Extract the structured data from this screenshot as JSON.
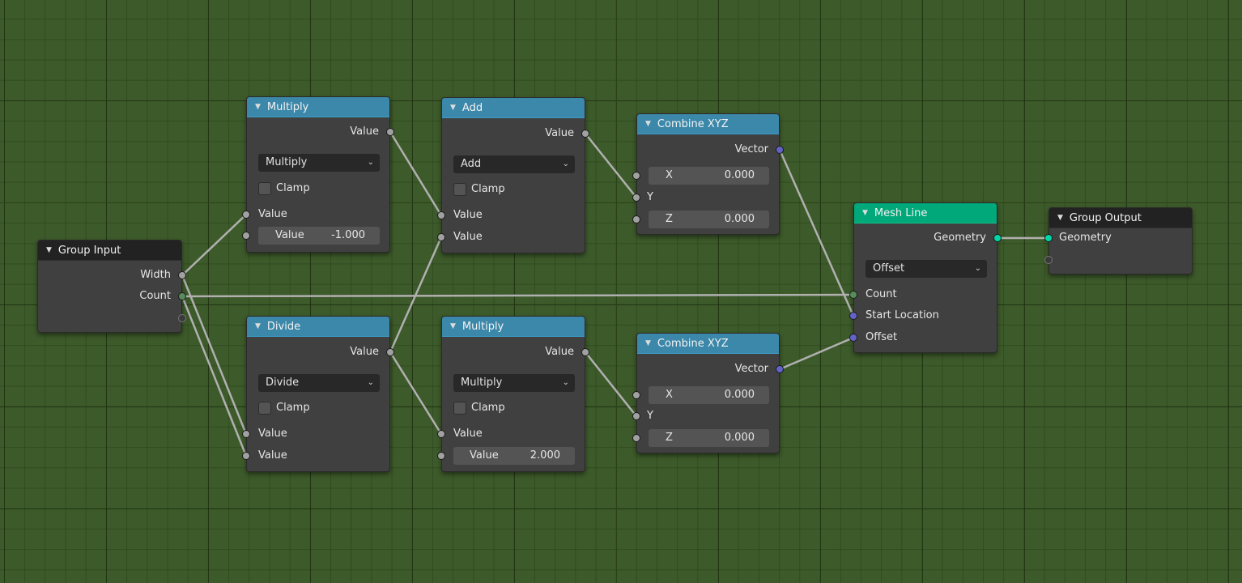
{
  "colors": {
    "background": "#3d5a2a",
    "math_header": "#3c88aa",
    "geometry_header": "#00a87a",
    "group_header": "#222222",
    "node_body": "#3f403f",
    "socket_float": "#a1a1a1",
    "socket_int": "#598c5c",
    "socket_vector": "#6363c7",
    "socket_geometry": "#00d6a3",
    "link": "#b0b0b0"
  },
  "icons": {
    "collapse": "▼",
    "chevron_down": "⌄"
  },
  "nodes": {
    "group_input": {
      "title": "Group Input",
      "out_width": "Width",
      "out_count": "Count"
    },
    "multiply_1": {
      "title": "Multiply",
      "out_value": "Value",
      "operation": "Multiply",
      "clamp_label": "Clamp",
      "in_value_1": "Value",
      "in_value_2_name": "Value",
      "in_value_2": "-1.000"
    },
    "add": {
      "title": "Add",
      "out_value": "Value",
      "operation": "Add",
      "clamp_label": "Clamp",
      "in_value_1": "Value",
      "in_value_2": "Value"
    },
    "combine_xyz_1": {
      "title": "Combine XYZ",
      "out_vector": "Vector",
      "x_label": "X",
      "x_value": "0.000",
      "y_label": "Y",
      "z_label": "Z",
      "z_value": "0.000"
    },
    "divide": {
      "title": "Divide",
      "out_value": "Value",
      "operation": "Divide",
      "clamp_label": "Clamp",
      "in_value_1": "Value",
      "in_value_2": "Value"
    },
    "multiply_2": {
      "title": "Multiply",
      "out_value": "Value",
      "operation": "Multiply",
      "clamp_label": "Clamp",
      "in_value_1": "Value",
      "in_value_2_name": "Value",
      "in_value_2": "2.000"
    },
    "combine_xyz_2": {
      "title": "Combine XYZ",
      "out_vector": "Vector",
      "x_label": "X",
      "x_value": "0.000",
      "y_label": "Y",
      "z_label": "Z",
      "z_value": "0.000"
    },
    "mesh_line": {
      "title": "Mesh Line",
      "out_geometry": "Geometry",
      "mode": "Offset",
      "in_count": "Count",
      "in_start_location": "Start Location",
      "in_offset": "Offset"
    },
    "group_output": {
      "title": "Group Output",
      "in_geometry": "Geometry"
    }
  },
  "links": [
    {
      "from": "group_input.width",
      "to": "multiply_1.value_1"
    },
    {
      "from": "group_input.width",
      "to": "divide.value_1"
    },
    {
      "from": "group_input.count",
      "to": "divide.value_2"
    },
    {
      "from": "group_input.count",
      "to": "mesh_line.count"
    },
    {
      "from": "multiply_1.value",
      "to": "add.value_1"
    },
    {
      "from": "divide.value",
      "to": "add.value_2"
    },
    {
      "from": "divide.value",
      "to": "multiply_2.value_1"
    },
    {
      "from": "add.value",
      "to": "combine_xyz_1.y"
    },
    {
      "from": "multiply_2.value",
      "to": "combine_xyz_2.y"
    },
    {
      "from": "combine_xyz_1.vector",
      "to": "mesh_line.start_location"
    },
    {
      "from": "combine_xyz_2.vector",
      "to": "mesh_line.offset"
    },
    {
      "from": "mesh_line.geometry",
      "to": "group_output.geometry"
    }
  ]
}
